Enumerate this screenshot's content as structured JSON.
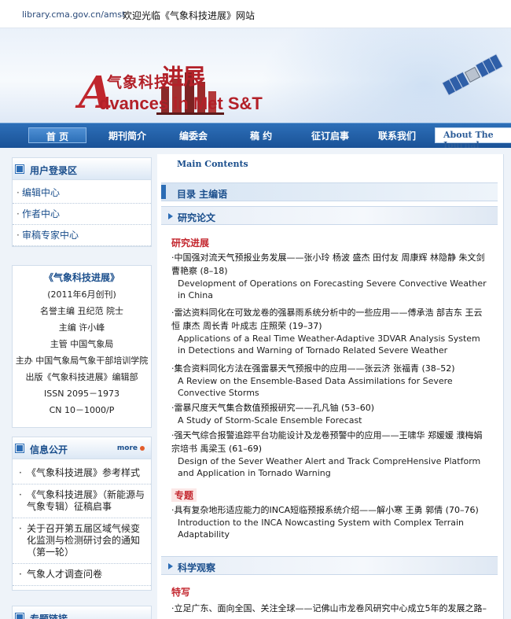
{
  "topbar": {
    "site": "library.cma.gov.cn/amst",
    "welcome": "欢迎光临《气象科技进展》网站"
  },
  "banner": {
    "logo_letter": "A",
    "logo_cn": "气象科技",
    "logo_jz": "进展",
    "logo_en": "dvances in Met S&T"
  },
  "nav": {
    "items": [
      "首 页",
      "期刊简介",
      "编委会",
      "稿 约",
      "征订启事",
      "联系我们"
    ],
    "about": "About The Journal"
  },
  "login_panel": {
    "title": "用户登录区",
    "links": [
      "编辑中心",
      "作者中心",
      "审稿专家中心"
    ]
  },
  "info_panel": {
    "lines": [
      "《气象科技进展》",
      "(2011年6月创刊)",
      "名誉主编  丑纪范  院士",
      "主编  许小峰",
      "主管  中国气象局",
      "主办  中国气象局气象干部培训学院",
      "出版《气象科技进展》编辑部",
      "ISSN 2095－1973",
      "CN 10－1000/P"
    ]
  },
  "notice_panel": {
    "title": "信息公开",
    "more": "more",
    "items": [
      "《气象科技进展》参考样式",
      "《气象科技进展》（新能源与气象专辑）征稿启事",
      "关于召开第五届区域气候变化监测与检测研讨会的通知（第一轮）",
      "气象人才调查问卷"
    ]
  },
  "bottom_panel": {
    "title": "专题链接"
  },
  "main": {
    "heading": "Main Contents",
    "contents_bar": "目录  主编语",
    "section1": "研究论文",
    "tag1": "研究进展",
    "articles1": [
      {
        "cn": "·中国强对流天气预报业务发展——张小玲 杨波 盛杰 田付友 周康辉 林隐静 朱文剑 曹艳察 (8–18)",
        "en": "Development of Operations on Forecasting Severe Convective Weather in China"
      },
      {
        "cn": "·雷达资料同化在可致龙卷的强暴雨系统分析中的一些应用——傅承浩 部吉东 王云恒 康杰 周长青 叶成志 庄照荣 (19–37)",
        "en": "Applications of a Real Time Weather-Adaptive 3DVAR Analysis System in Detections and Warning of Tornado Related Severe Weather"
      },
      {
        "cn": "·集合资料同化方法在强雷暴天气预报中的应用——张云济 张福青 (38–52)",
        "en": "A Review on the Ensemble-Based Data Assimilations for Severe Convective Storms"
      },
      {
        "cn": "·雷暴尺度天气集合数值预报研究——孔凡铀 (53–60)",
        "en": "A Study of Storm-Scale Ensemble Forecast"
      },
      {
        "cn": "·强天气综合报警追踪平台功能设计及龙卷预警中的应用——王啸华 郑媛媛 濮梅娟 宗培书 禹梁玉 (61–69)",
        "en": "Design of the Sever Weather Alert and Track CompreHensive Platform and Application in Tornado Warning"
      }
    ],
    "tag2": "专题",
    "articles2": [
      {
        "cn": "·具有复杂地形适应能力的INCA短临预报系统介绍——解小寒 王勇 郭倩 (70–76)",
        "en": "Introduction to the INCA Nowcasting System with Complex Terrain Adaptability"
      }
    ],
    "section2": "科学观察",
    "tag3": "特写",
    "articles3": [
      {
        "cn": "·立足广东、面向全国、关注全球——记佛山市龙卷风研究中心成立5年的发展之路–"
      }
    ]
  }
}
